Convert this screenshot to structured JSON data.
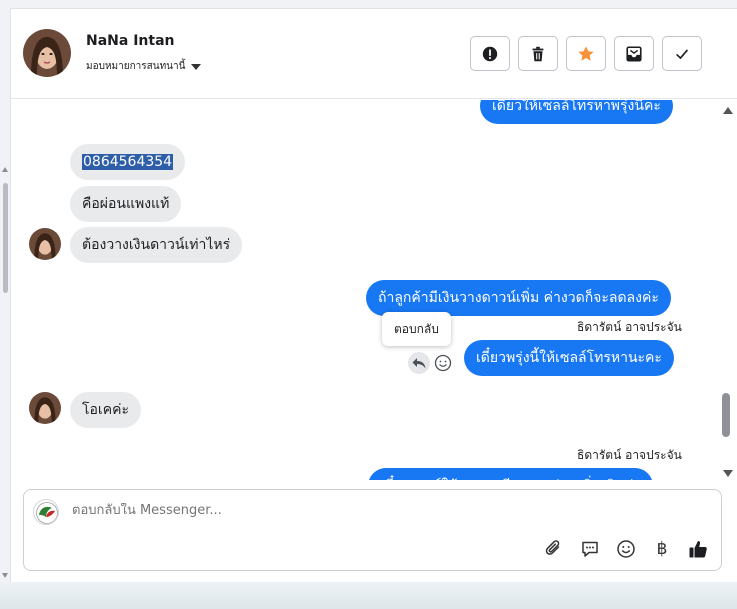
{
  "header": {
    "contact_name": "NaNa Intan",
    "assign_label": "มอบหมายการสนทนานี้",
    "actions": [
      "mark-spam",
      "delete",
      "star",
      "move-to-inbox",
      "mark-done"
    ]
  },
  "messages": {
    "in_phone": "0864564354",
    "in_2": "คือผ่อนแพงแท้",
    "in_3": "ต้องวางเงินดาวน์เท่าไหร่",
    "out_top": "เดี๋ยวให้เซลล์โทรหาพรุ่งนี้คะ",
    "out_1": "ถ้าลูกค้ามีเงินวางดาวน์เพิ่ม ค่างวดก็จะลดลงค่ะ",
    "sender_1": "ธิดารัตน์ อาจประจัน",
    "out_2": "เดี๋ยวพรุ่งนี้ให้เซลล์โทรหานะคะ",
    "in_4": "โอเคค่ะ",
    "sender_2": "ธิดารัตน์ อาจประจัน",
    "out_partial": "เดี๋ยวเซลล์ให้รายละเอียดการผ่อนเพิ่มเติมค่ะ"
  },
  "tooltip": {
    "reply": "ตอบกลับ"
  },
  "composer": {
    "placeholder": "ตอบกลับใน Messenger..."
  },
  "colors": {
    "outgoing": "#1877f2",
    "incoming": "#e9eaec",
    "star": "#f7923a"
  }
}
